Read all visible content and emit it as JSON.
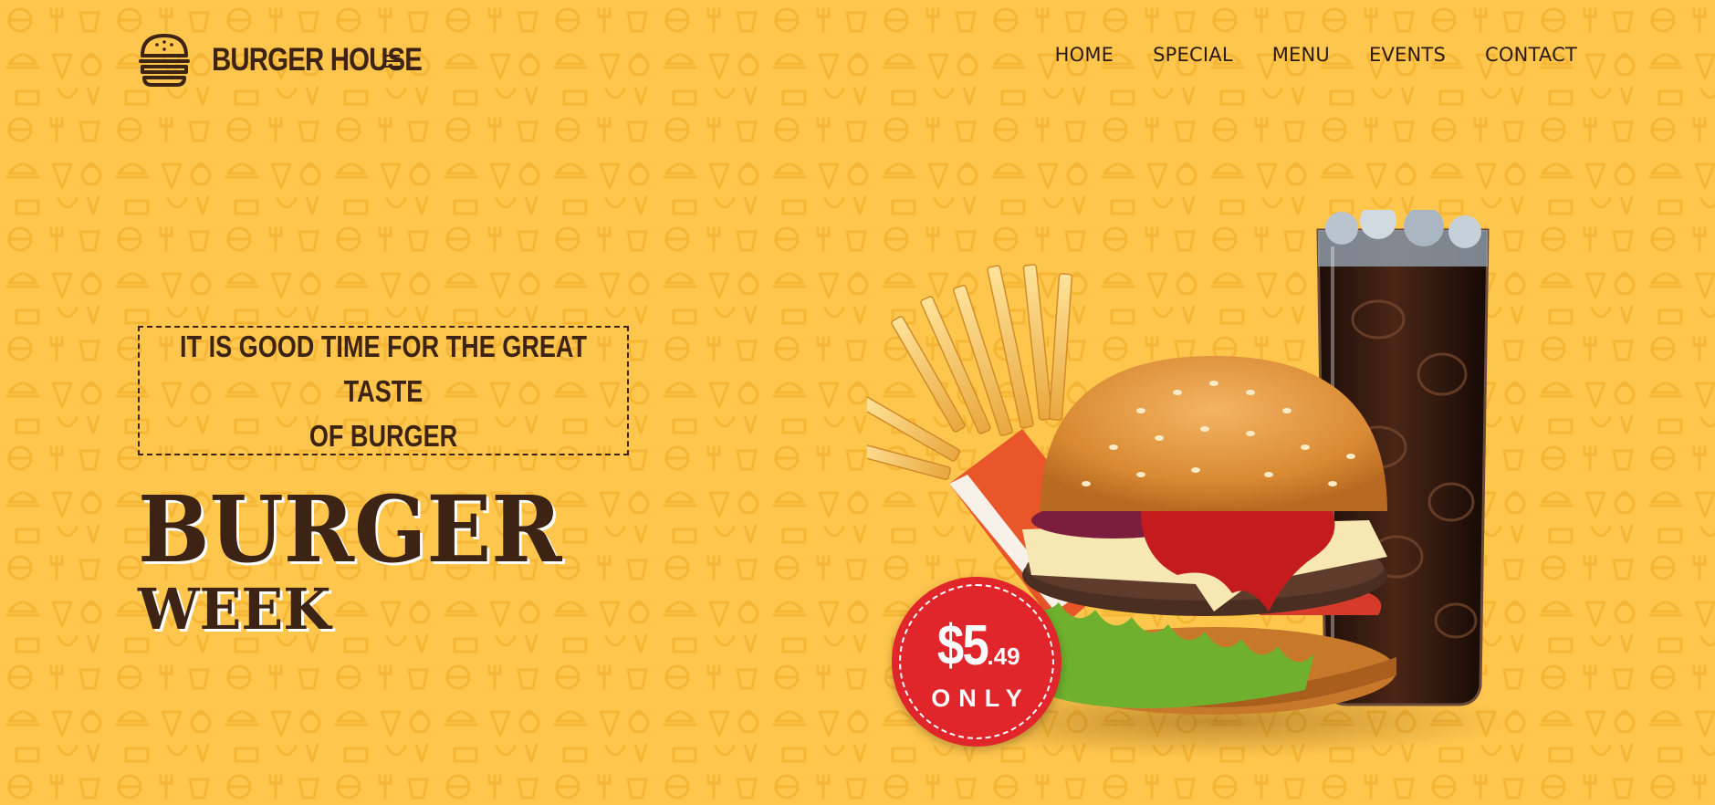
{
  "colors": {
    "background": "#FFC64D",
    "brand_brown": "#3D2314",
    "nav_text": "#2A1A12",
    "badge_red": "#E0262A"
  },
  "header": {
    "logo_icon": "burger-icon",
    "brand": "BURGER HOUSE",
    "menu_icon": "hamburger-menu-icon",
    "nav": [
      "HOME",
      "SPECIAL",
      "MENU",
      "EVENTS",
      "CONTACT"
    ]
  },
  "hero": {
    "tagline_line1": "IT IS GOOD TIME FOR THE GREAT TASTE",
    "tagline_line2": "OF BURGER",
    "headline_line1": "BURGER",
    "headline_line2": "WEEK"
  },
  "price_badge": {
    "dollars": "$5",
    "cents": ".49",
    "note": "ONLY"
  },
  "image": {
    "subject": "burger-fries-cola-image"
  }
}
